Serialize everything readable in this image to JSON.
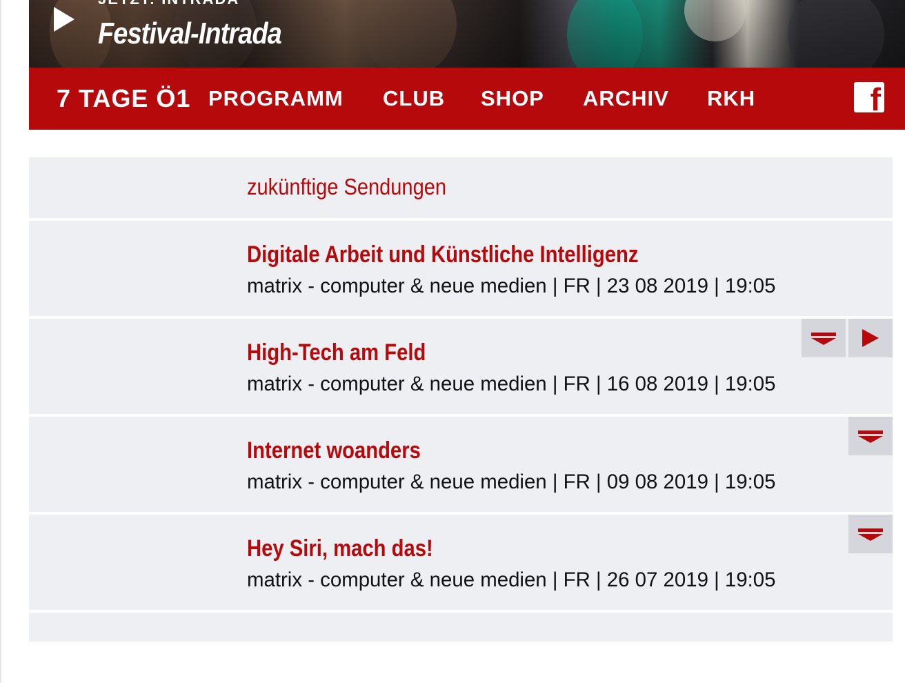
{
  "hero": {
    "kicker": "JETZT: INTRADA",
    "title": "Festival-Intrada"
  },
  "nav": {
    "items": [
      {
        "label": "7 TAGE Ö1"
      },
      {
        "label": "PROGRAMM"
      },
      {
        "label": "CLUB"
      },
      {
        "label": "SHOP"
      },
      {
        "label": "ARCHIV"
      },
      {
        "label": "RKH"
      }
    ],
    "social_icon": "facebook-icon",
    "social_glyph": "f"
  },
  "broadcasts": {
    "section_title": "zukünftige Sendungen",
    "items": [
      {
        "title": "Digitale Arbeit und Künstliche Intelligenz",
        "meta": "matrix - computer & neue medien | FR | 23 08 2019 | 19:05"
      },
      {
        "title": "High-Tech am Feld",
        "meta": "matrix - computer & neue medien | FR | 16 08 2019 | 19:05"
      },
      {
        "title": "Internet woanders",
        "meta": "matrix - computer & neue medien | FR | 09 08 2019 | 19:05"
      },
      {
        "title": "Hey Siri, mach das!",
        "meta": "matrix - computer & neue medien | FR | 26 07 2019 | 19:05"
      }
    ]
  },
  "colors": {
    "brand_red": "#b5090c",
    "row_background": "#eeeff3",
    "button_background": "#d5d6dc"
  }
}
